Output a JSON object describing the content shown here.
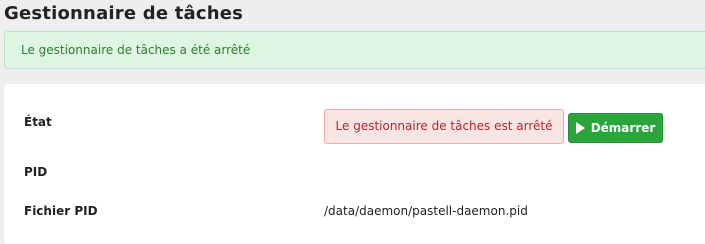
{
  "page": {
    "title": "Gestionnaire de tâches"
  },
  "alert": {
    "message": "Le gestionnaire de tâches a été arrêté"
  },
  "details": {
    "state_label": "État",
    "state_status": "Le gestionnaire de tâches est arrêté",
    "start_button_label": "Démarrer",
    "pid_label": "PID",
    "pid_value": "",
    "pid_file_label": "Fichier PID",
    "pid_file_value": "/data/daemon/pastell-daemon.pid"
  },
  "colors": {
    "success_bg": "#dff5e3",
    "danger_bg": "#fbe4e4",
    "danger_text": "#b02a2a",
    "button_green": "#2aa53c"
  },
  "icons": {
    "start": "play-icon"
  }
}
